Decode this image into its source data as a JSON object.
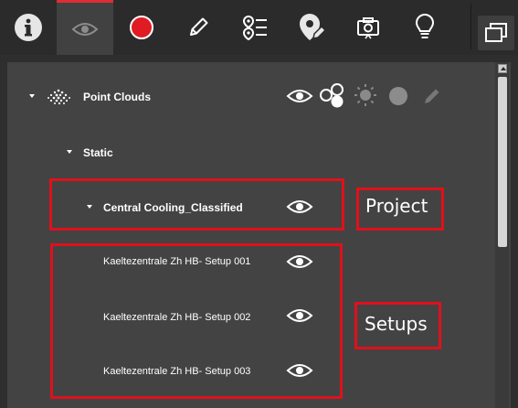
{
  "toolbar": {
    "items": [
      {
        "name": "info-icon"
      },
      {
        "name": "eye-icon",
        "active": true
      },
      {
        "name": "record-icon"
      },
      {
        "name": "pencil-icon"
      },
      {
        "name": "route-list-icon"
      },
      {
        "name": "location-edit-icon"
      },
      {
        "name": "camera-icon"
      },
      {
        "name": "lightbulb-icon"
      }
    ],
    "window_button": "window-icon"
  },
  "tree": {
    "root": {
      "label": "Point Clouds"
    },
    "group": {
      "label": "Static"
    },
    "project": {
      "label": "Central Cooling_Classified"
    },
    "setups": [
      {
        "label": "Kaeltezentrale Zh HB- Setup 001"
      },
      {
        "label": "Kaeltezentrale Zh HB- Setup 002"
      },
      {
        "label": "Kaeltezentrale Zh HB- Setup 003"
      }
    ]
  },
  "annotations": {
    "project": "Project",
    "setups": "Setups"
  },
  "colors": {
    "accent": "#e02c36",
    "highlight_box": "#e0101c",
    "record": "#e01b24"
  }
}
